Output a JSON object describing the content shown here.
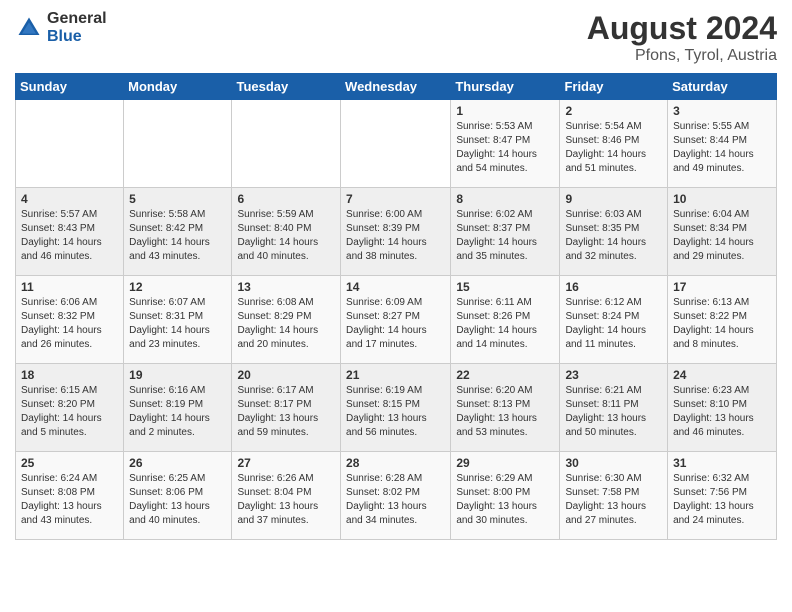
{
  "header": {
    "logo_general": "General",
    "logo_blue": "Blue",
    "main_title": "August 2024",
    "subtitle": "Pfons, Tyrol, Austria"
  },
  "days_of_week": [
    "Sunday",
    "Monday",
    "Tuesday",
    "Wednesday",
    "Thursday",
    "Friday",
    "Saturday"
  ],
  "weeks": [
    [
      {
        "day": "",
        "info": ""
      },
      {
        "day": "",
        "info": ""
      },
      {
        "day": "",
        "info": ""
      },
      {
        "day": "",
        "info": ""
      },
      {
        "day": "1",
        "info": "Sunrise: 5:53 AM\nSunset: 8:47 PM\nDaylight: 14 hours\nand 54 minutes."
      },
      {
        "day": "2",
        "info": "Sunrise: 5:54 AM\nSunset: 8:46 PM\nDaylight: 14 hours\nand 51 minutes."
      },
      {
        "day": "3",
        "info": "Sunrise: 5:55 AM\nSunset: 8:44 PM\nDaylight: 14 hours\nand 49 minutes."
      }
    ],
    [
      {
        "day": "4",
        "info": "Sunrise: 5:57 AM\nSunset: 8:43 PM\nDaylight: 14 hours\nand 46 minutes."
      },
      {
        "day": "5",
        "info": "Sunrise: 5:58 AM\nSunset: 8:42 PM\nDaylight: 14 hours\nand 43 minutes."
      },
      {
        "day": "6",
        "info": "Sunrise: 5:59 AM\nSunset: 8:40 PM\nDaylight: 14 hours\nand 40 minutes."
      },
      {
        "day": "7",
        "info": "Sunrise: 6:00 AM\nSunset: 8:39 PM\nDaylight: 14 hours\nand 38 minutes."
      },
      {
        "day": "8",
        "info": "Sunrise: 6:02 AM\nSunset: 8:37 PM\nDaylight: 14 hours\nand 35 minutes."
      },
      {
        "day": "9",
        "info": "Sunrise: 6:03 AM\nSunset: 8:35 PM\nDaylight: 14 hours\nand 32 minutes."
      },
      {
        "day": "10",
        "info": "Sunrise: 6:04 AM\nSunset: 8:34 PM\nDaylight: 14 hours\nand 29 minutes."
      }
    ],
    [
      {
        "day": "11",
        "info": "Sunrise: 6:06 AM\nSunset: 8:32 PM\nDaylight: 14 hours\nand 26 minutes."
      },
      {
        "day": "12",
        "info": "Sunrise: 6:07 AM\nSunset: 8:31 PM\nDaylight: 14 hours\nand 23 minutes."
      },
      {
        "day": "13",
        "info": "Sunrise: 6:08 AM\nSunset: 8:29 PM\nDaylight: 14 hours\nand 20 minutes."
      },
      {
        "day": "14",
        "info": "Sunrise: 6:09 AM\nSunset: 8:27 PM\nDaylight: 14 hours\nand 17 minutes."
      },
      {
        "day": "15",
        "info": "Sunrise: 6:11 AM\nSunset: 8:26 PM\nDaylight: 14 hours\nand 14 minutes."
      },
      {
        "day": "16",
        "info": "Sunrise: 6:12 AM\nSunset: 8:24 PM\nDaylight: 14 hours\nand 11 minutes."
      },
      {
        "day": "17",
        "info": "Sunrise: 6:13 AM\nSunset: 8:22 PM\nDaylight: 14 hours\nand 8 minutes."
      }
    ],
    [
      {
        "day": "18",
        "info": "Sunrise: 6:15 AM\nSunset: 8:20 PM\nDaylight: 14 hours\nand 5 minutes."
      },
      {
        "day": "19",
        "info": "Sunrise: 6:16 AM\nSunset: 8:19 PM\nDaylight: 14 hours\nand 2 minutes."
      },
      {
        "day": "20",
        "info": "Sunrise: 6:17 AM\nSunset: 8:17 PM\nDaylight: 13 hours\nand 59 minutes."
      },
      {
        "day": "21",
        "info": "Sunrise: 6:19 AM\nSunset: 8:15 PM\nDaylight: 13 hours\nand 56 minutes."
      },
      {
        "day": "22",
        "info": "Sunrise: 6:20 AM\nSunset: 8:13 PM\nDaylight: 13 hours\nand 53 minutes."
      },
      {
        "day": "23",
        "info": "Sunrise: 6:21 AM\nSunset: 8:11 PM\nDaylight: 13 hours\nand 50 minutes."
      },
      {
        "day": "24",
        "info": "Sunrise: 6:23 AM\nSunset: 8:10 PM\nDaylight: 13 hours\nand 46 minutes."
      }
    ],
    [
      {
        "day": "25",
        "info": "Sunrise: 6:24 AM\nSunset: 8:08 PM\nDaylight: 13 hours\nand 43 minutes."
      },
      {
        "day": "26",
        "info": "Sunrise: 6:25 AM\nSunset: 8:06 PM\nDaylight: 13 hours\nand 40 minutes."
      },
      {
        "day": "27",
        "info": "Sunrise: 6:26 AM\nSunset: 8:04 PM\nDaylight: 13 hours\nand 37 minutes."
      },
      {
        "day": "28",
        "info": "Sunrise: 6:28 AM\nSunset: 8:02 PM\nDaylight: 13 hours\nand 34 minutes."
      },
      {
        "day": "29",
        "info": "Sunrise: 6:29 AM\nSunset: 8:00 PM\nDaylight: 13 hours\nand 30 minutes."
      },
      {
        "day": "30",
        "info": "Sunrise: 6:30 AM\nSunset: 7:58 PM\nDaylight: 13 hours\nand 27 minutes."
      },
      {
        "day": "31",
        "info": "Sunrise: 6:32 AM\nSunset: 7:56 PM\nDaylight: 13 hours\nand 24 minutes."
      }
    ]
  ]
}
